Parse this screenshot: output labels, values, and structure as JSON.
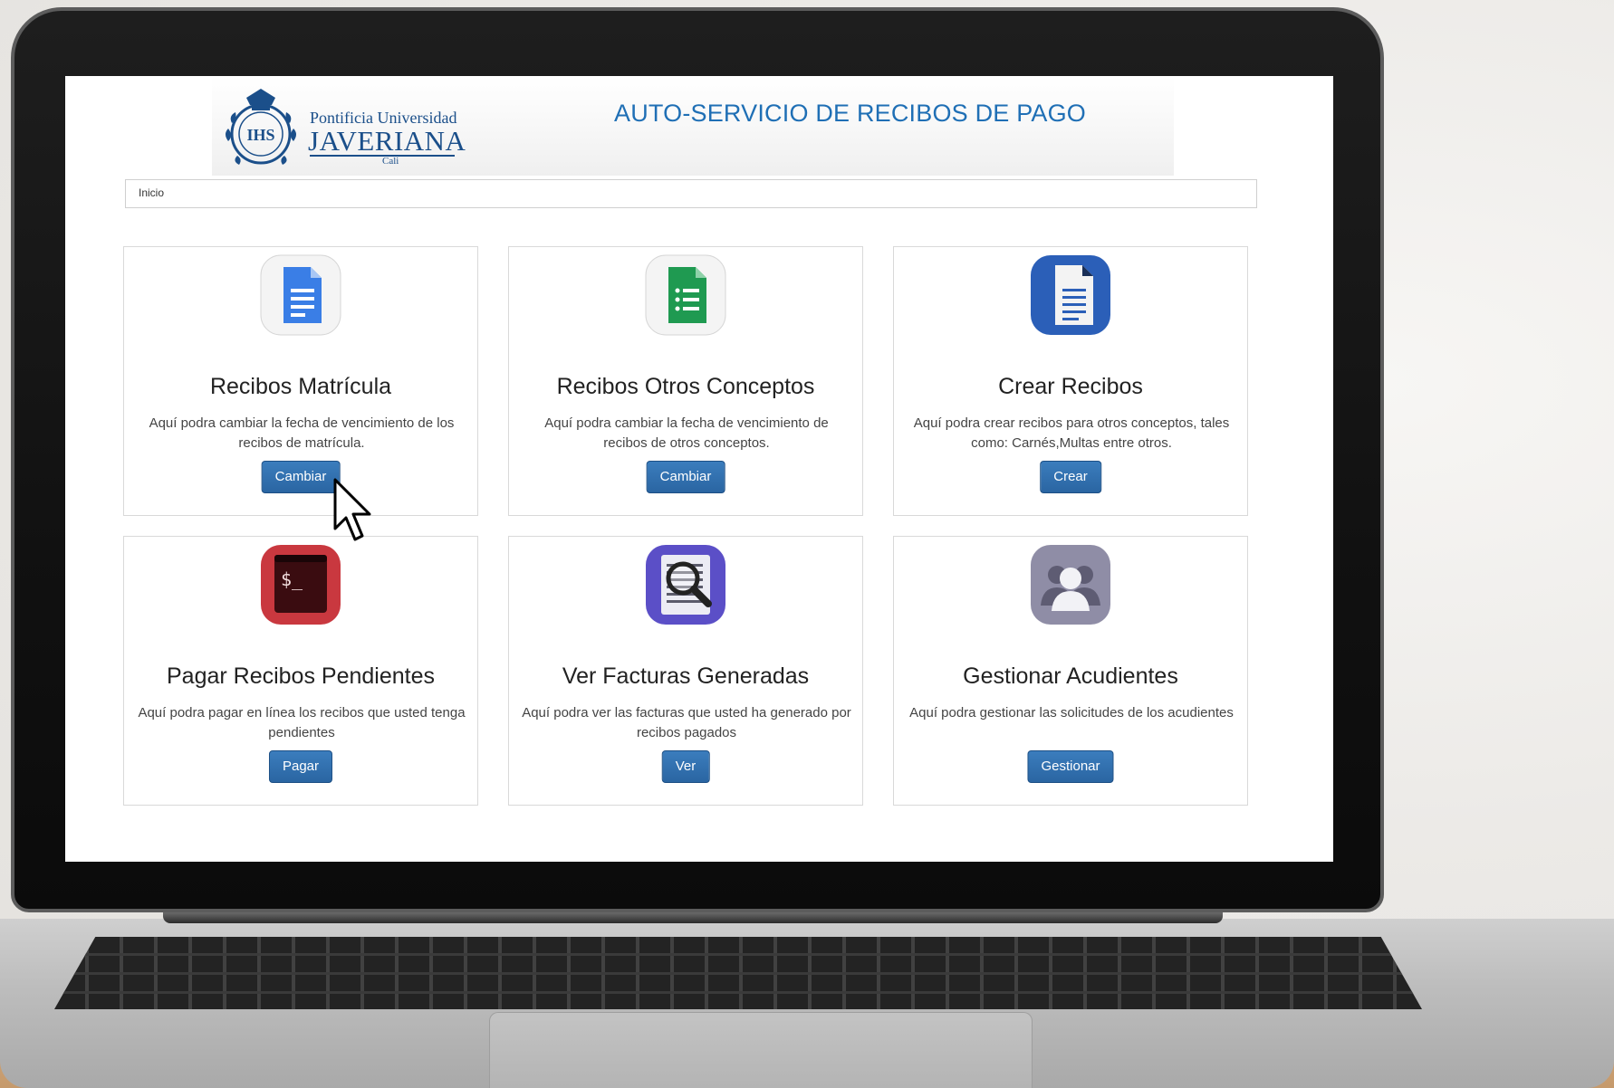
{
  "header": {
    "logo_line_1": "Pontificia Universidad",
    "logo_line_2": "JAVERIANA",
    "logo_line_3": "Cali",
    "title": "AUTO-SERVICIO DE RECIBOS DE PAGO"
  },
  "breadcrumb": {
    "item": "Inicio"
  },
  "cards": [
    {
      "icon": "document-icon",
      "title": "Recibos Matrícula",
      "description": "Aquí podra cambiar la fecha de vencimiento de los recibos de matrícula.",
      "button": "Cambiar"
    },
    {
      "icon": "spreadsheet-list-icon",
      "title": "Recibos Otros Conceptos",
      "description": "Aquí podra cambiar la fecha de vencimiento de recibos de otros conceptos.",
      "button": "Cambiar"
    },
    {
      "icon": "text-document-icon",
      "title": "Crear Recibos",
      "description": "Aquí podra crear recibos para otros conceptos, tales como: Carnés,Multas entre otros.",
      "button": "Crear"
    },
    {
      "icon": "terminal-icon",
      "title": "Pagar Recibos Pendientes",
      "description": "Aquí podra pagar en línea los recibos que usted tenga pendientes",
      "button": "Pagar"
    },
    {
      "icon": "search-document-icon",
      "title": "Ver Facturas Generadas",
      "description": "Aquí podra ver las facturas que usted ha generado por recibos pagados",
      "button": "Ver"
    },
    {
      "icon": "users-icon",
      "title": "Gestionar Acudientes",
      "description": "Aquí podra gestionar las solicitudes de los acudientes",
      "button": "Gestionar"
    }
  ],
  "colors": {
    "primary_blue": "#2a65a2",
    "title_blue": "#1f6fb5",
    "logo_blue": "#1b4f8a"
  }
}
